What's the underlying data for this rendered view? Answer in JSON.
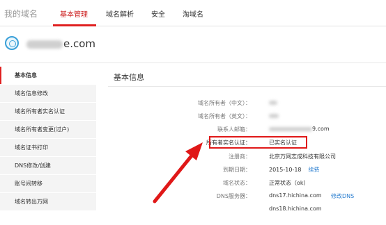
{
  "header": {
    "brand": "我的域名",
    "tabs": [
      {
        "label": "基本管理",
        "active": true
      },
      {
        "label": "域名解析",
        "active": false
      },
      {
        "label": "安全",
        "active": false
      },
      {
        "label": "淘域名",
        "active": false
      }
    ]
  },
  "domain": {
    "name_suffix": "e.com"
  },
  "sidebar": {
    "items": [
      {
        "label": "基本信息",
        "active": true
      },
      {
        "label": "域名信息修改",
        "active": false
      },
      {
        "label": "域名所有者实名认证",
        "active": false
      },
      {
        "label": "域名所有者变更(过户)",
        "active": false
      },
      {
        "label": "域名证书打印",
        "active": false
      },
      {
        "label": "DNS修改/创建",
        "active": false
      },
      {
        "label": "账号间转移",
        "active": false
      },
      {
        "label": "域名转出万网",
        "active": false
      }
    ]
  },
  "content": {
    "title": "基本信息",
    "rows": [
      {
        "label": "域名所有者（中文）：",
        "value": ""
      },
      {
        "label": "域名所有者（英文）：",
        "value": ""
      },
      {
        "label": "联系人邮箱：",
        "value": "9.com"
      },
      {
        "label": "所有者实名认证：",
        "value": "已实名认证"
      },
      {
        "label": "注册商：",
        "value": "北京万网志成科技有限公司"
      },
      {
        "label": "到期日期：",
        "value": "2015-10-18",
        "link": "续费"
      },
      {
        "label": "域名状态：",
        "value": "正常状态（ok）"
      },
      {
        "label": "DNS服务器：",
        "value": "dns17.hichina.com",
        "link": "修改DNS"
      },
      {
        "label": "",
        "value": "dns18.hichina.com"
      }
    ]
  },
  "colors": {
    "accent": "#e02020",
    "link": "#2b7fd0"
  }
}
